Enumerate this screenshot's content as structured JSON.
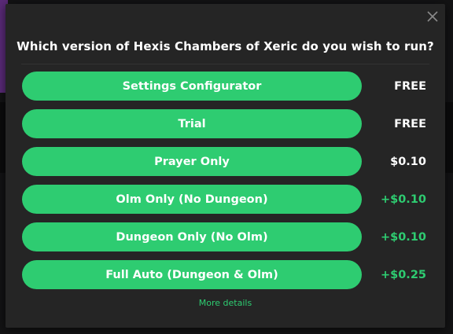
{
  "modal": {
    "title": "Which version of Hexis Chambers of Xeric do you wish to run?",
    "more_details": "More details",
    "close_icon": "close-icon"
  },
  "options": [
    {
      "label": "Settings Configurator",
      "price": "FREE",
      "price_color": "#ffffff"
    },
    {
      "label": "Trial",
      "price": "FREE",
      "price_color": "#ffffff"
    },
    {
      "label": "Prayer Only",
      "price": "$0.10",
      "price_color": "#ffffff"
    },
    {
      "label": "Olm Only (No Dungeon)",
      "price": "+$0.10",
      "price_color": "#2ecc71"
    },
    {
      "label": "Dungeon Only (No Olm)",
      "price": "+$0.10",
      "price_color": "#2ecc71"
    },
    {
      "label": "Full Auto (Dungeon & Olm)",
      "price": "+$0.25",
      "price_color": "#2ecc71"
    }
  ],
  "colors": {
    "accent": "#2ecc71",
    "modal_bg": "#252525",
    "text": "#ffffff"
  }
}
